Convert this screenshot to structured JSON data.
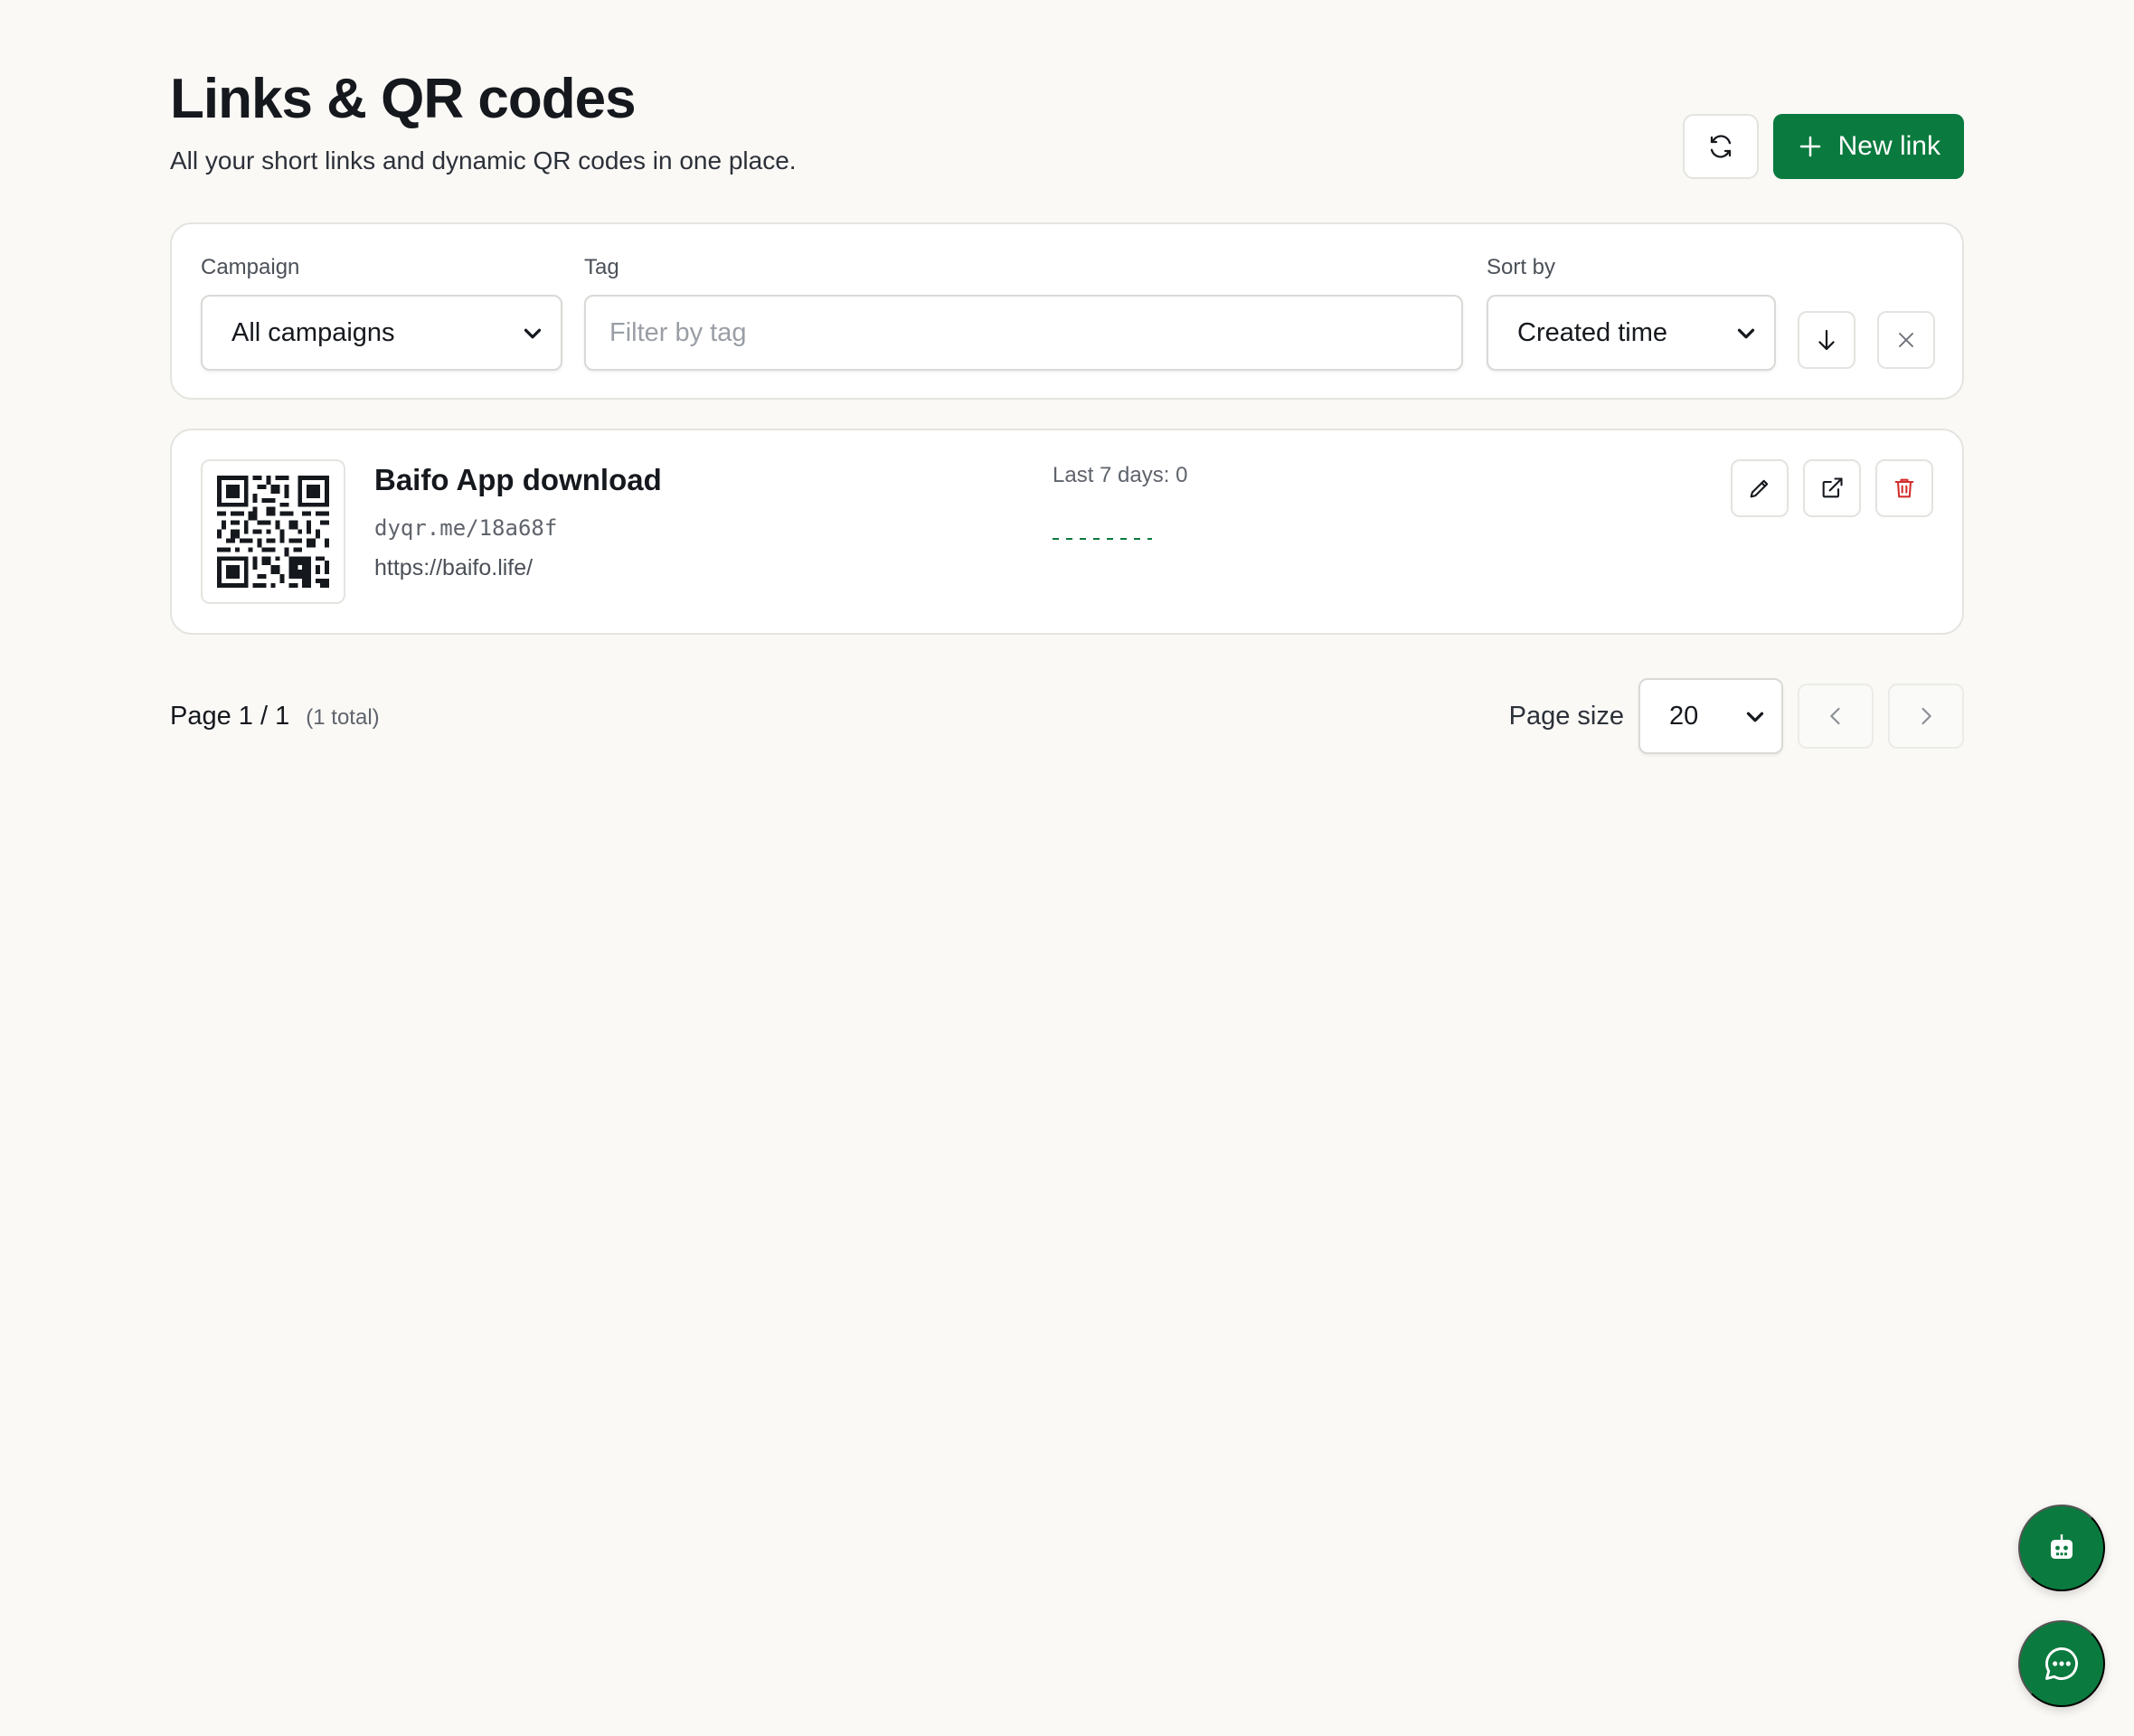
{
  "header": {
    "title": "Links & QR codes",
    "subtitle": "All your short links and dynamic QR codes in one place.",
    "new_link_label": "New link",
    "refresh_icon": "refresh-icon",
    "plus_icon": "plus-icon"
  },
  "filters": {
    "campaign_label": "Campaign",
    "campaign_value": "All campaigns",
    "tag_label": "Tag",
    "tag_placeholder": "Filter by tag",
    "sort_label": "Sort by",
    "sort_value": "Created time",
    "sort_direction_icon": "arrow-down-icon",
    "clear_icon": "close-icon"
  },
  "links": [
    {
      "title": "Baifo App download",
      "short_url": "dyqr.me/18a68f",
      "target_url": "https://baifo.life/",
      "stats_label": "Last 7 days: 0",
      "sparkline_values": [
        0,
        0,
        0,
        0,
        0,
        0,
        0
      ]
    }
  ],
  "pagination": {
    "page_text": "Page 1 / 1",
    "total_text": "(1 total)",
    "page_size_label": "Page size",
    "page_size_value": "20"
  },
  "colors": {
    "accent": "#0b7a3e",
    "danger": "#d32f2f",
    "background": "#faf9f6"
  },
  "floating": {
    "assistant_icon": "robot-icon",
    "chat_icon": "chat-icon"
  }
}
